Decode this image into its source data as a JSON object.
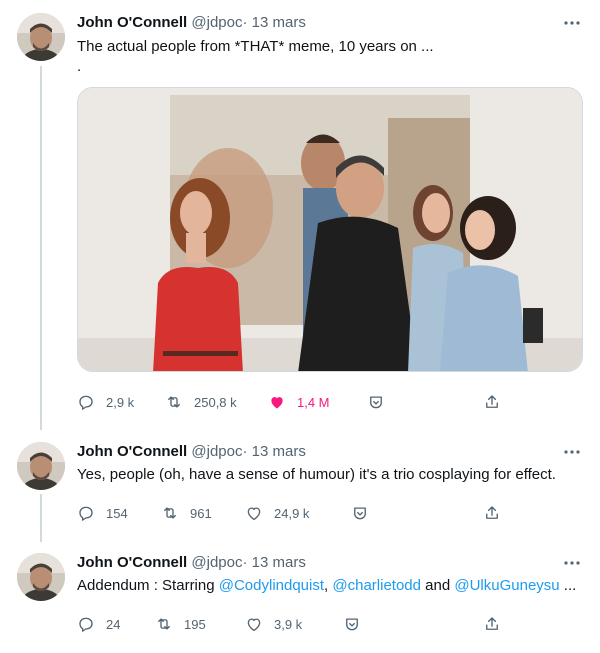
{
  "colors": {
    "accent": "#1d9bf0",
    "like_active": "#f91880",
    "secondary_text": "#536471",
    "thread_line": "#cfd9de"
  },
  "tweets": [
    {
      "name": "John O'Connell",
      "handle": "@jdpoc",
      "dot": "·",
      "date": "13 mars",
      "text_line1": "The actual people from *THAT* meme, 10 years on ...",
      "text_line2": ".",
      "replies": "2,9 k",
      "retweets": "250,8 k",
      "likes": "1,4 M",
      "liked": true
    },
    {
      "name": "John O'Connell",
      "handle": "@jdpoc",
      "dot": "·",
      "date": "13 mars",
      "text": "Yes, people (oh, have a sense of humour) it's a trio cosplaying for effect.",
      "replies": "154",
      "retweets": "961",
      "likes": "24,9 k",
      "liked": false
    },
    {
      "name": "John O'Connell",
      "handle": "@jdpoc",
      "dot": "·",
      "date": "13 mars",
      "text_prefix": "Addendum : Starring ",
      "mention1": "@Codylindquist",
      "sep1": ", ",
      "mention2": "@charlietodd",
      "sep2": " and ",
      "mention3": "@UlkuGuneysu",
      "text_suffix": " ...",
      "replies": "24",
      "retweets": "195",
      "likes": "3,9 k",
      "liked": false
    }
  ]
}
